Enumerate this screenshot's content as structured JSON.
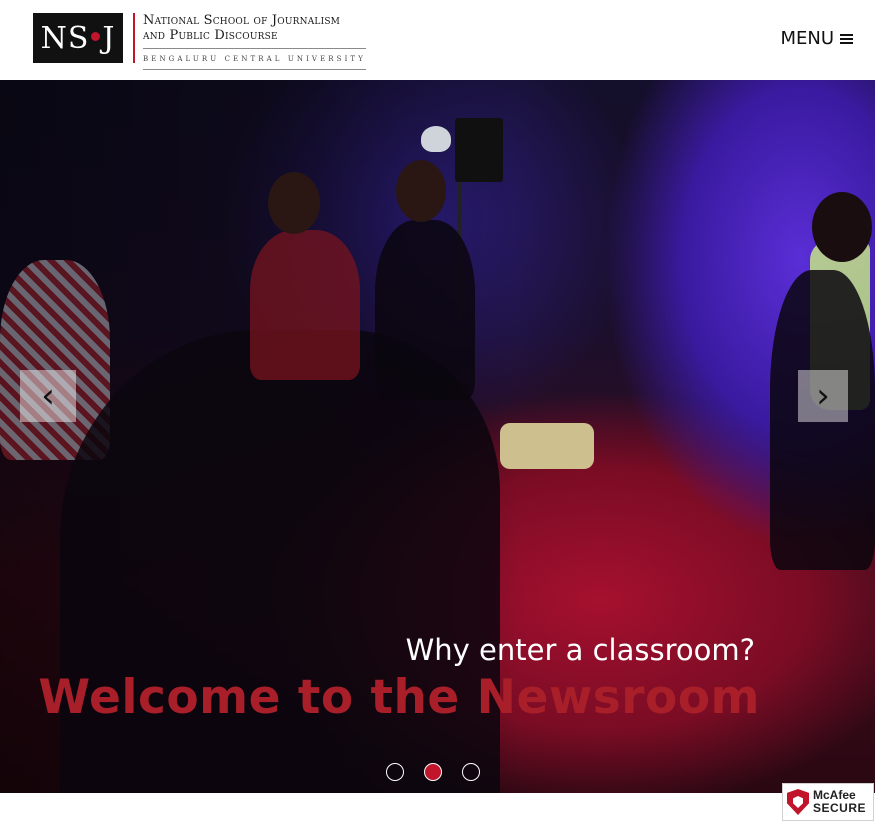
{
  "header": {
    "logo": {
      "mark_left": "N",
      "mark_mid": "S",
      "mark_right": "J",
      "line1": "National School of Journalism",
      "line2": "and Public Discourse",
      "sub": "BENGALURU CENTRAL UNIVERSITY"
    },
    "menu_label": "MENU"
  },
  "hero": {
    "caption_sub": "Why enter a classroom?",
    "caption_main": "Welcome to the Newsroom",
    "prev_label": "‹",
    "next_label": "›",
    "slides_total": 3,
    "active_slide": 2
  },
  "badge": {
    "brand": "McAfee",
    "label": "SECURE",
    "icon": "shield-icon"
  },
  "colors": {
    "accent": "#c0152a",
    "caption_main": "#a81f2a"
  }
}
